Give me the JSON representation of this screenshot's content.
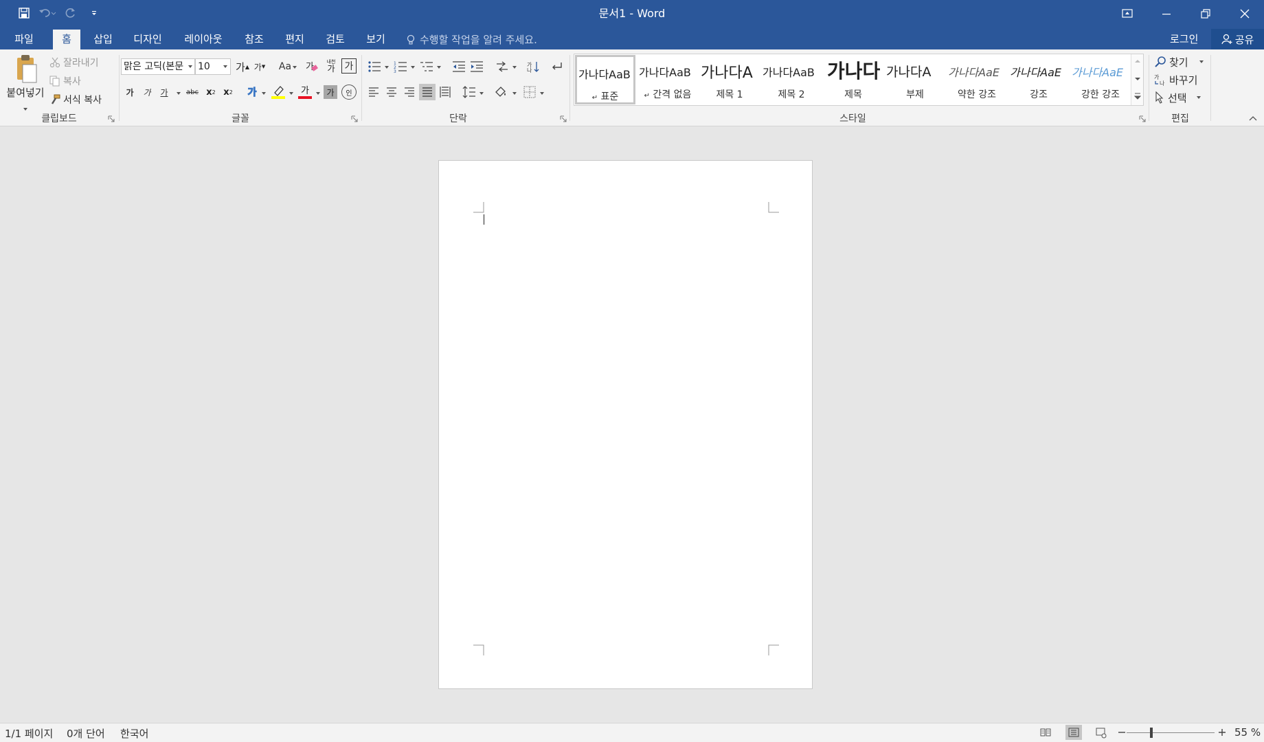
{
  "window": {
    "title": "문서1 - Word"
  },
  "quick_access": {
    "icons": [
      "save-icon",
      "undo-icon",
      "redo-icon",
      "customize-qat-icon"
    ]
  },
  "tabs": [
    {
      "label": "파일"
    },
    {
      "label": "홈"
    },
    {
      "label": "삽입"
    },
    {
      "label": "디자인"
    },
    {
      "label": "레이아웃"
    },
    {
      "label": "참조"
    },
    {
      "label": "편지"
    },
    {
      "label": "검토"
    },
    {
      "label": "보기"
    }
  ],
  "active_tab": "홈",
  "tell_me": "수행할 작업을 알려 주세요.",
  "account": {
    "login": "로그인",
    "share": "공유"
  },
  "clipboard": {
    "group_label": "클립보드",
    "paste": "붙여넣기",
    "cut": "잘라내기",
    "copy": "복사",
    "format_painter": "서식 복사"
  },
  "font": {
    "group_label": "글꼴",
    "font_name": "맑은 고딕(본문",
    "font_size": "10",
    "grow": "가",
    "shrink": "가",
    "change_case": "Aa",
    "bold": "가",
    "italic": "가",
    "underline": "가",
    "strikethrough": "abc",
    "subscript": "x",
    "subscript_mark": "2",
    "superscript": "x",
    "superscript_mark": "2",
    "text_effect": "가",
    "font_color": "가",
    "char_shading": "가",
    "enclose": "인",
    "phonetic": "가",
    "phonetic_top": "내천",
    "border_char": "가"
  },
  "paragraph": {
    "group_label": "단락"
  },
  "styles": {
    "group_label": "스타일",
    "items": [
      {
        "preview": "가나다AaB",
        "name": "표준",
        "mark": "↵"
      },
      {
        "preview": "가나다AaB",
        "name": "간격 없음",
        "mark": "↵"
      },
      {
        "preview": "가나다A",
        "name": "제목 1"
      },
      {
        "preview": "가나다AaB",
        "name": "제목 2"
      },
      {
        "preview": "가나다",
        "name": "제목"
      },
      {
        "preview": "가나다A",
        "name": "부제"
      },
      {
        "preview": "가나다AaE",
        "name": "약한 강조"
      },
      {
        "preview": "가나다AaE",
        "name": "강조"
      },
      {
        "preview": "가나다AaE",
        "name": "강한 강조"
      }
    ]
  },
  "editing": {
    "group_label": "편집",
    "find": "찾기",
    "replace": "바꾸기",
    "select": "선택"
  },
  "status": {
    "page": "1/1 페이지",
    "words": "0개 단어",
    "language": "한국어",
    "zoom": "55 %",
    "zoom_level": 0.55
  },
  "colors": {
    "brand": "#2b579a",
    "highlight": "#ffff00",
    "font_color": "#e81123"
  }
}
